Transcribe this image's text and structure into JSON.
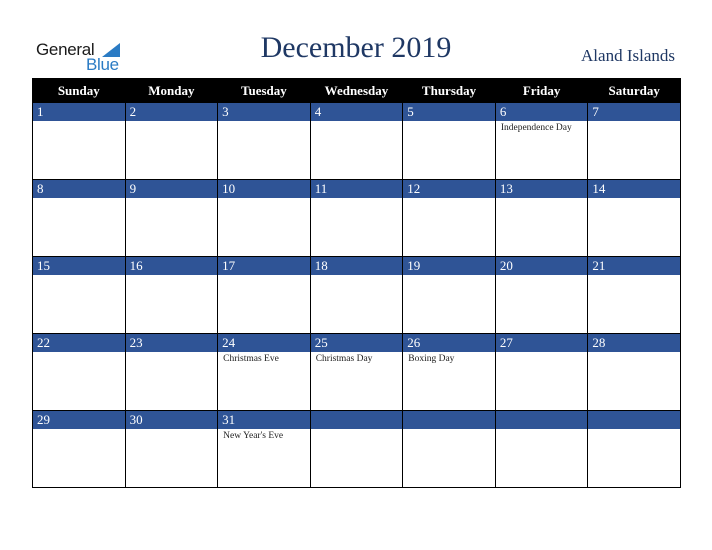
{
  "logo": {
    "line1": "General",
    "line2": "Blue"
  },
  "title": "December 2019",
  "country": "Aland Islands",
  "colors": {
    "band": "#2f5496",
    "header": "#000000",
    "title": "#1f3864",
    "logo_blue": "#2a7bc4"
  },
  "weekdays": [
    "Sunday",
    "Monday",
    "Tuesday",
    "Wednesday",
    "Thursday",
    "Friday",
    "Saturday"
  ],
  "weeks": [
    [
      {
        "day": "1",
        "holiday": ""
      },
      {
        "day": "2",
        "holiday": ""
      },
      {
        "day": "3",
        "holiday": ""
      },
      {
        "day": "4",
        "holiday": ""
      },
      {
        "day": "5",
        "holiday": ""
      },
      {
        "day": "6",
        "holiday": "Independence Day"
      },
      {
        "day": "7",
        "holiday": ""
      }
    ],
    [
      {
        "day": "8",
        "holiday": ""
      },
      {
        "day": "9",
        "holiday": ""
      },
      {
        "day": "10",
        "holiday": ""
      },
      {
        "day": "11",
        "holiday": ""
      },
      {
        "day": "12",
        "holiday": ""
      },
      {
        "day": "13",
        "holiday": ""
      },
      {
        "day": "14",
        "holiday": ""
      }
    ],
    [
      {
        "day": "15",
        "holiday": ""
      },
      {
        "day": "16",
        "holiday": ""
      },
      {
        "day": "17",
        "holiday": ""
      },
      {
        "day": "18",
        "holiday": ""
      },
      {
        "day": "19",
        "holiday": ""
      },
      {
        "day": "20",
        "holiday": ""
      },
      {
        "day": "21",
        "holiday": ""
      }
    ],
    [
      {
        "day": "22",
        "holiday": ""
      },
      {
        "day": "23",
        "holiday": ""
      },
      {
        "day": "24",
        "holiday": "Christmas Eve"
      },
      {
        "day": "25",
        "holiday": "Christmas Day"
      },
      {
        "day": "26",
        "holiday": "Boxing Day"
      },
      {
        "day": "27",
        "holiday": ""
      },
      {
        "day": "28",
        "holiday": ""
      }
    ],
    [
      {
        "day": "29",
        "holiday": ""
      },
      {
        "day": "30",
        "holiday": ""
      },
      {
        "day": "31",
        "holiday": "New Year's Eve"
      },
      {
        "day": "",
        "holiday": ""
      },
      {
        "day": "",
        "holiday": ""
      },
      {
        "day": "",
        "holiday": ""
      },
      {
        "day": "",
        "holiday": ""
      }
    ]
  ]
}
